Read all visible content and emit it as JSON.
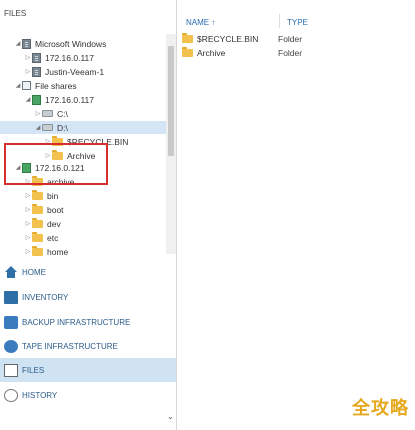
{
  "left": {
    "title": "FILES",
    "tree": [
      {
        "label": "Microsoft Windows",
        "icon": "server-group-icon",
        "level": 0,
        "arrow": "expanded"
      },
      {
        "label": "172.16.0.117",
        "icon": "server-icon",
        "level": 1,
        "arrow": "collapsed"
      },
      {
        "label": "Justin-Veeam-1",
        "icon": "server-icon",
        "level": 1,
        "arrow": "collapsed"
      },
      {
        "label": "File shares",
        "icon": "file-shares-icon",
        "level": 0,
        "arrow": "expanded"
      },
      {
        "label": "172.16.0.117",
        "icon": "share-server-icon",
        "level": 1,
        "arrow": "expanded"
      },
      {
        "label": "C:\\",
        "icon": "drive-icon",
        "level": 2,
        "arrow": "collapsed"
      },
      {
        "label": "D:\\",
        "icon": "drive-icon",
        "level": 2,
        "arrow": "expanded",
        "selected": true
      },
      {
        "label": "$RECYCLE.BIN",
        "icon": "folder-icon",
        "level": 3,
        "arrow": "collapsed"
      },
      {
        "label": "Archive",
        "icon": "folder-icon",
        "level": 3,
        "arrow": "collapsed"
      },
      {
        "label": "172.16.0.121",
        "icon": "share-server-icon",
        "level": 1,
        "arrow": "expanded"
      },
      {
        "label": "archive",
        "icon": "folder-icon",
        "level": 2,
        "arrow": "collapsed"
      },
      {
        "label": "bin",
        "icon": "folder-icon",
        "level": 2,
        "arrow": "collapsed"
      },
      {
        "label": "boot",
        "icon": "folder-icon",
        "level": 2,
        "arrow": "collapsed"
      },
      {
        "label": "dev",
        "icon": "folder-icon",
        "level": 2,
        "arrow": "collapsed"
      },
      {
        "label": "etc",
        "icon": "folder-icon",
        "level": 2,
        "arrow": "collapsed"
      },
      {
        "label": "home",
        "icon": "folder-icon",
        "level": 2,
        "arrow": "collapsed"
      }
    ],
    "nav": [
      {
        "label": "HOME",
        "icon": "home-icon"
      },
      {
        "label": "INVENTORY",
        "icon": "inventory-icon"
      },
      {
        "label": "BACKUP INFRASTRUCTURE",
        "icon": "backup-infrastructure-icon"
      },
      {
        "label": "TAPE INFRASTRUCTURE",
        "icon": "tape-icon"
      },
      {
        "label": "FILES",
        "icon": "files-icon",
        "active": true
      },
      {
        "label": "HISTORY",
        "icon": "history-icon"
      }
    ]
  },
  "right": {
    "columns": {
      "name": "NAME",
      "type": "TYPE"
    },
    "rows": [
      {
        "name": "$RECYCLE.BIN",
        "type": "Folder"
      },
      {
        "name": "Archive",
        "type": "Folder"
      }
    ]
  },
  "watermark": "全攻略",
  "colors": {
    "highlight": "#d62d2d",
    "accent": "#2b6cb0",
    "folder": "#f2c14e",
    "selected": "#d4e6f6"
  }
}
